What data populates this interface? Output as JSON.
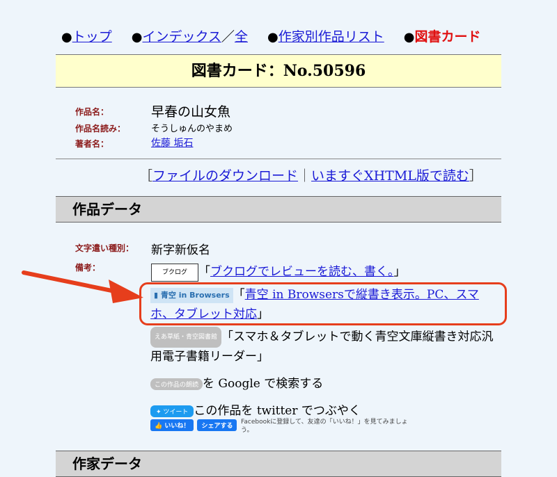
{
  "nav": {
    "items": [
      {
        "bullet": "●",
        "label": "トップ"
      },
      {
        "bullet": "●",
        "label": "インデックス"
      },
      {
        "sep": "／"
      },
      {
        "label": "全"
      },
      {
        "bullet": "●",
        "label": "作家別作品リスト"
      },
      {
        "bullet": "●",
        "label": "図書カード"
      }
    ],
    "top": "トップ",
    "index": "インデックス",
    "slash": "／",
    "all": "全",
    "author_list": "作家別作品リスト",
    "card": "図書カード",
    "bullet": "●"
  },
  "card_title": "図書カード：No.50596",
  "work": {
    "title_label": "作品名：",
    "title": "早春の山女魚",
    "reading_label": "作品名読み：",
    "reading": "そうしゅんのやまめ",
    "author_label": "著者名：",
    "author": "佐藤 垢石"
  },
  "download": {
    "open": "［",
    "file": "ファイルのダウンロード",
    "sep": "｜",
    "xhtml": "いますぐXHTML版で読む",
    "close": "］"
  },
  "section1": "作品データ",
  "data": {
    "kana_label": "文字遣い種別：",
    "kana": "新字新仮名",
    "notes_label": "備考：",
    "booklog_icon": "ブクログ",
    "booklog_open": "「",
    "booklog_text": "ブクログでレビューを読む、書く。",
    "booklog_close": "」",
    "aozora_badge": "青空 in Browsers",
    "aozora_open": "「",
    "aozora_text": "青空 in Browsersで縦書き表示。PC、スマホ、タブレット対応",
    "aozora_close": "」",
    "ea_badge": "えあ草紙・青空図書館",
    "ea_text": "「スマホ＆タブレットで動く青空文庫縦書き対応汎用電子書籍リーダー」",
    "reading_badge": "この作品の朗読",
    "google_text": "を Google で検索する",
    "tweet_badge": "ツイート",
    "tweet_text": "この作品を twitter でつぶやく",
    "like_btn": "いいね！",
    "share_btn": "シェアする",
    "fb_text": "Facebookに登録して、友達の「いいね！」を見てみましょう。"
  },
  "section2": "作家データ"
}
